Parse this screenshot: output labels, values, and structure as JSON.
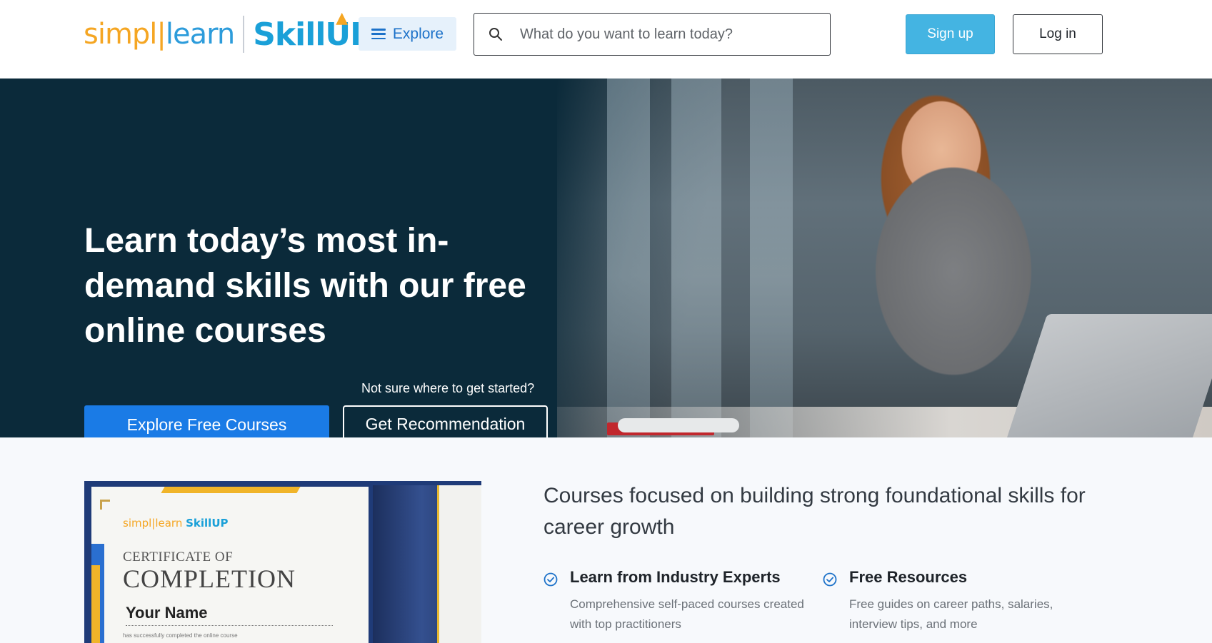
{
  "header": {
    "logo": {
      "simpli": "simpl",
      "learn": "learn",
      "brand": "SkillUP"
    },
    "explore_label": "Explore",
    "search_placeholder": "What do you want to learn today?",
    "signup_label": "Sign up",
    "login_label": "Log in"
  },
  "hero": {
    "title": "Learn today’s most in-demand skills with our free online courses",
    "hint": "Not sure where to get started?",
    "explore_free_label": "Explore Free Courses",
    "recommend_label": "Get Recommendation"
  },
  "certificate": {
    "logo_simpli": "simpl|learn",
    "logo_brand": "SkillUP",
    "of_label": "CERTIFICATE OF",
    "completion_label": "COMPLETION",
    "name": "Your Name",
    "small_text": "has successfully completed the online course"
  },
  "features": {
    "heading": "Courses focused on building strong foundational skills for career growth",
    "items": [
      {
        "title": "Learn from Industry Experts",
        "desc": "Comprehensive self-paced courses created with top practitioners"
      },
      {
        "title": "Free Resources",
        "desc": "Free guides on career paths, salaries, interview tips, and more"
      }
    ]
  },
  "colors": {
    "accent": "#1a7be6",
    "hero_bg": "#0b2a3a",
    "signup": "#44b4e2",
    "check": "#1d72c9"
  },
  "icons": [
    "hamburger-icon",
    "search-icon",
    "check-circle-icon"
  ]
}
